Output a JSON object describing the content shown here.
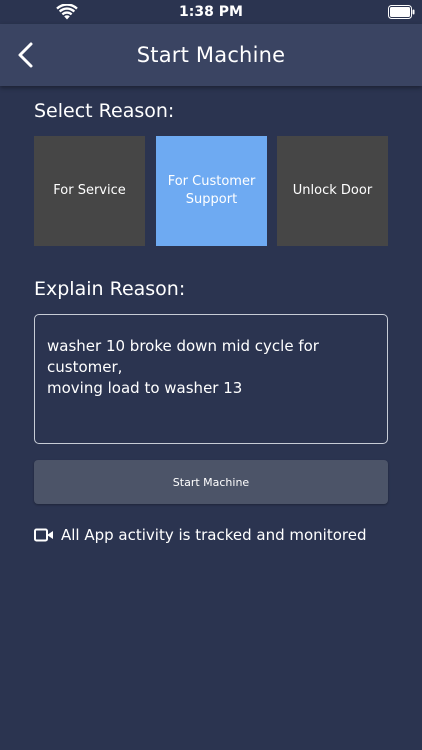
{
  "status_bar": {
    "time": "1:38 PM",
    "wifi_icon": "wifi-icon",
    "battery_icon": "battery-icon"
  },
  "nav": {
    "title": "Start Machine",
    "back_icon": "chevron-left-icon"
  },
  "select_reason": {
    "heading": "Select Reason:",
    "options": [
      {
        "label": "For Service",
        "selected": false
      },
      {
        "label": "For Customer Support",
        "selected": true
      },
      {
        "label": "Unlock Door",
        "selected": false
      }
    ]
  },
  "explain_reason": {
    "heading": "Explain Reason:",
    "value": "washer 10 broke down mid cycle for customer,\nmoving load to washer 13"
  },
  "start_button": {
    "label": "Start Machine"
  },
  "notice": {
    "icon": "video-camera-icon",
    "text": "All App activity is tracked and monitored"
  },
  "colors": {
    "background": "#2b3450",
    "nav_bar": "#3a4462",
    "option_default": "#464646",
    "option_selected": "#6eaaf2",
    "button": "#4c5468"
  }
}
